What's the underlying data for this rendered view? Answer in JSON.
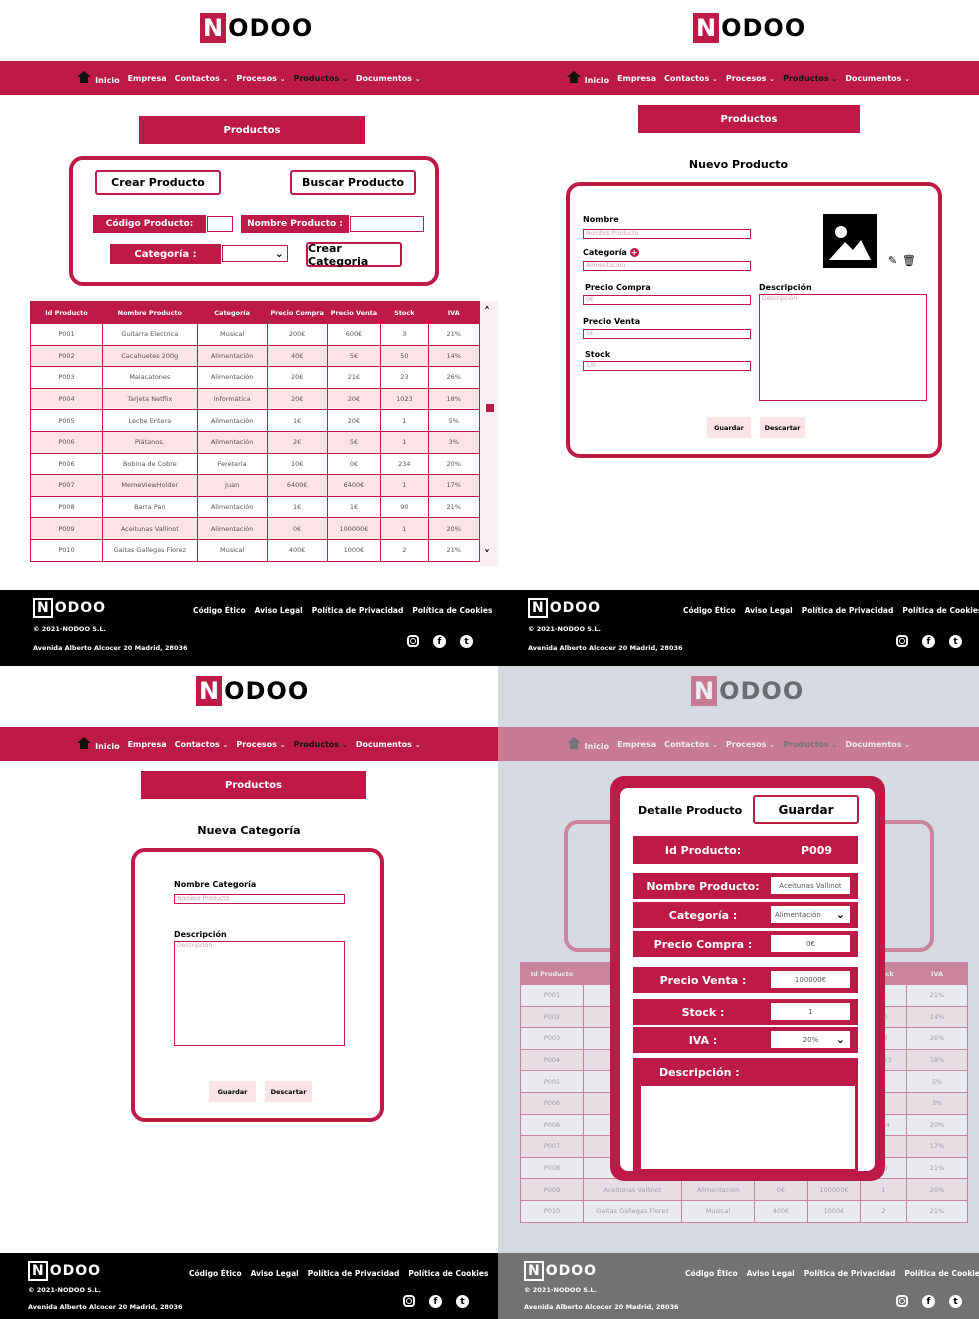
{
  "brand": {
    "n": "N",
    "rest": "ODOO"
  },
  "nav": {
    "inicio": "Inicio",
    "empresa": "Empresa",
    "contactos": "Contactos",
    "procesos": "Procesos",
    "productos": "Productos",
    "documentos": "Documentos"
  },
  "section_title": "Productos",
  "p1": {
    "crear_producto": "Crear Producto",
    "buscar_producto": "Buscar Producto",
    "codigo_label": "Código Producto:",
    "nombre_label": "Nombre Producto :",
    "categoria_label": "Categoría :",
    "crear_categoria": "Crear Categoria",
    "table": {
      "headers": [
        "Id Producto",
        "Nombre Producto",
        "Categoría",
        "Precio Compra",
        "Precio Venta",
        "Stock",
        "IVA"
      ],
      "rows": [
        [
          "P001",
          "Guitarra Electrica",
          "Musical",
          "200€",
          "600€",
          "3",
          "21%"
        ],
        [
          "P002",
          "Cacahuetes 200g",
          "Alimentación",
          "40€",
          "5€",
          "50",
          "14%"
        ],
        [
          "P003",
          "Malacatones",
          "Alimentación",
          "20€",
          "21€",
          "23",
          "26%"
        ],
        [
          "P004",
          "Tarjeta Netflix",
          "Informática",
          "20€",
          "20€",
          "1023",
          "18%"
        ],
        [
          "P005",
          "Leche Entera",
          "Alimentación",
          "1€",
          "20€",
          "1",
          "5%"
        ],
        [
          "P006",
          "Plátanos.",
          "Alimentación",
          "2€",
          "5€",
          "1",
          "3%"
        ],
        [
          "P006",
          "Bobina de Cobre",
          "Fereteria",
          "10€",
          "0€",
          "234",
          "20%"
        ],
        [
          "P007",
          "MemeViewHolder",
          "Juan",
          "6400€",
          "6400€",
          "1",
          "17%"
        ],
        [
          "P008",
          "Barra Pan",
          "Alimentación",
          "1€",
          "1€",
          "90",
          "21%"
        ],
        [
          "P009",
          "Aceitunas Vallinot",
          "Alimentación",
          "0€",
          "100000€",
          "1",
          "20%"
        ],
        [
          "P010",
          "Gaitas Gallegas Florez",
          "Musical",
          "400€",
          "1000€",
          "2",
          "21%"
        ]
      ]
    }
  },
  "p2": {
    "title": "Nuevo Producto",
    "nombre": "Nombre",
    "nombre_ph": "Nombre Producto",
    "categoria": "Categoría",
    "categoria_ph": "Alimentacion",
    "precio_compra": "Precio Compra",
    "precio_compra_ph": "0€",
    "precio_venta": "Precio Venta",
    "precio_venta_ph": "1€",
    "stock": "Stock",
    "stock_ph": "1/0",
    "descripcion": "Descripción",
    "descripcion_ph": "Descripción",
    "guardar": "Guardar",
    "descartar": "Descartar"
  },
  "p3": {
    "title": "Nueva Categoría",
    "nombre": "Nombre Categoría",
    "nombre_ph": "Nombre Producto",
    "descripcion": "Descripción",
    "descripcion_ph": "Descripción",
    "guardar": "Guardar",
    "descartar": "Descartar"
  },
  "p4": {
    "title": "Detalle Producto",
    "guardar": "Guardar",
    "id_label": "Id Producto:",
    "id_value": "P009",
    "nombre_label": "Nombre Producto:",
    "nombre_value": "Aceitunas Vallinot",
    "categoria_label": "Categoría :",
    "categoria_value": "Alimentación",
    "pcompra_label": "Precio Compra :",
    "pcompra_value": "0€",
    "pventa_label": "Precio Venta :",
    "pventa_value": "100000€",
    "stock_label": "Stock :",
    "stock_value": "1",
    "iva_label": "IVA :",
    "iva_value": "20%",
    "desc_label": "Descripción :",
    "bg_rows": [
      [
        "P001",
        "21%"
      ],
      [
        "P002",
        "14%"
      ],
      [
        "P003",
        "26%"
      ],
      [
        "P004",
        "18%"
      ],
      [
        "P005",
        "5%"
      ],
      [
        "P006",
        "3%"
      ],
      [
        "P006",
        "20%"
      ],
      [
        "P007",
        "17%"
      ],
      [
        "P008",
        "21%"
      ],
      [
        "P009",
        "20%"
      ],
      [
        "P010",
        "21%"
      ]
    ],
    "bg_stock": [
      "3",
      "50",
      "23",
      "1023",
      "1",
      "1",
      "234",
      "1",
      "90",
      "1",
      "2"
    ],
    "bg_row9": [
      "Aceitunas Vallinot",
      "Alimentación",
      "0€",
      "100000€"
    ],
    "bg_row10": [
      "Gaitas Gallegas Florez",
      "Musical",
      "400€",
      "1000€"
    ],
    "bg_p07": "M",
    "bg_p06": "B",
    "bg_p01": "G",
    "bg_p02": "C",
    "bg_head_id": "Id Producto",
    "bg_head_stock": "Stock",
    "bg_head_iva": "IVA"
  },
  "footer": {
    "copyright": "© 2021-NODOO S.L.",
    "address": "Avenida Alberto Alcocer 20 Madrid, 28036",
    "links": [
      "Código Ético",
      "Aviso Legal",
      "Política de Privacidad",
      "Política de Cookies"
    ],
    "social_icons": [
      "instagram-icon",
      "facebook-icon",
      "twitter-icon"
    ]
  },
  "colors": {
    "brand": "#bd1a47",
    "pink_row": "#fbe3e6",
    "footer": "#000000",
    "overlay": "#d5dae2"
  }
}
